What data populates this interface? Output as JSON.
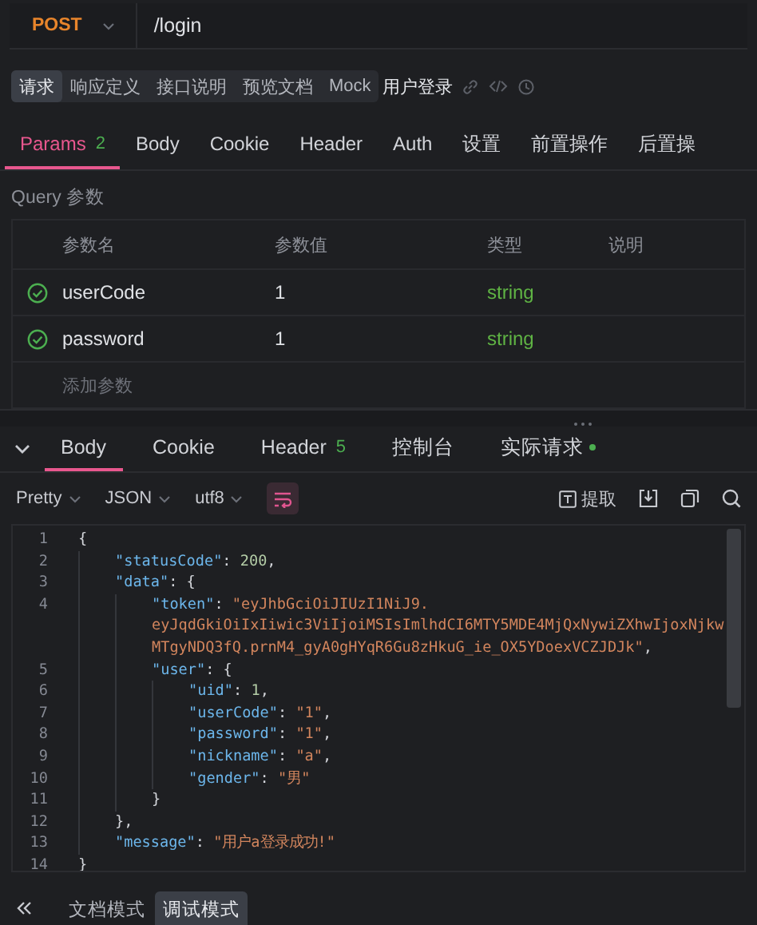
{
  "request": {
    "method": "POST",
    "url": "/login"
  },
  "doc_tabs": [
    {
      "label": "请求",
      "selected": true
    },
    {
      "label": "响应定义",
      "selected": false
    },
    {
      "label": "接口说明",
      "selected": false
    },
    {
      "label": "预览文档",
      "selected": false
    },
    {
      "label": "Mock",
      "selected": false
    }
  ],
  "api_name": "用户登录",
  "request_tabs": [
    {
      "label": "Params",
      "badge": "2",
      "selected": true
    },
    {
      "label": "Body",
      "selected": false
    },
    {
      "label": "Cookie",
      "selected": false
    },
    {
      "label": "Header",
      "selected": false
    },
    {
      "label": "Auth",
      "selected": false
    },
    {
      "label": "设置",
      "selected": false
    },
    {
      "label": "前置操作",
      "selected": false
    },
    {
      "label": "后置操",
      "selected": false
    }
  ],
  "query_label": "Query 参数",
  "params_table": {
    "columns": [
      "参数名",
      "参数值",
      "类型",
      "说明"
    ],
    "rows": [
      {
        "enabled": true,
        "name": "userCode",
        "value": "1",
        "type": "string"
      },
      {
        "enabled": true,
        "name": "password",
        "value": "1",
        "type": "string"
      }
    ],
    "add_row": "添加参数"
  },
  "response_tabs": [
    {
      "label": "Body",
      "selected": true
    },
    {
      "label": "Cookie",
      "selected": false
    },
    {
      "label": "Header",
      "badge": "5",
      "selected": false
    },
    {
      "label": "控制台",
      "selected": false
    },
    {
      "label": "实际请求",
      "dot": true,
      "selected": false
    }
  ],
  "response_toolbar": {
    "dropdowns": [
      "Pretty",
      "JSON",
      "utf8"
    ],
    "wrap_on": true,
    "extract_label": "提取"
  },
  "code_lines": [
    {
      "number": "1",
      "tokens": [
        {
          "kind": "punct",
          "text": "{"
        }
      ]
    },
    {
      "number": "2",
      "tokens": [
        {
          "kind": "key",
          "text": "\"statusCode\""
        },
        {
          "kind": "punct",
          "text": ": "
        },
        {
          "kind": "number",
          "text": "200"
        },
        {
          "kind": "punct",
          "text": ","
        }
      ]
    },
    {
      "number": "3",
      "tokens": [
        {
          "kind": "key",
          "text": "\"data\""
        },
        {
          "kind": "punct",
          "text": ": {"
        }
      ]
    },
    {
      "number": "4",
      "tokens": [
        {
          "kind": "key",
          "text": "\"token\""
        },
        {
          "kind": "punct",
          "text": ": "
        },
        {
          "kind": "string",
          "parts": [
            "\"eyJhbGciOiJIUzI1NiJ9.",
            "eyJqdGkiOiIxIiwic3ViIjoiMSIsImlhdCI6MTY5MDE4MjQxNywiZXhwIjoxNjkw",
            "MTgyNDQ3fQ.prnM4_gyA0gHYqR6Gu8zHkuG_ie_OX5YDoexVCZJDJk\""
          ]
        },
        {
          "kind": "punct",
          "text": ","
        }
      ]
    },
    {
      "number": "5",
      "tokens": [
        {
          "kind": "key",
          "text": "\"user\""
        },
        {
          "kind": "punct",
          "text": ": {"
        }
      ]
    },
    {
      "number": "6",
      "tokens": [
        {
          "kind": "key",
          "text": "\"uid\""
        },
        {
          "kind": "punct",
          "text": ": "
        },
        {
          "kind": "number",
          "text": "1"
        },
        {
          "kind": "punct",
          "text": ","
        }
      ]
    },
    {
      "number": "7",
      "tokens": [
        {
          "kind": "key",
          "text": "\"userCode\""
        },
        {
          "kind": "punct",
          "text": ": "
        },
        {
          "kind": "string",
          "text": "\"1\""
        },
        {
          "kind": "punct",
          "text": ","
        }
      ]
    },
    {
      "number": "8",
      "tokens": [
        {
          "kind": "key",
          "text": "\"password\""
        },
        {
          "kind": "punct",
          "text": ": "
        },
        {
          "kind": "string",
          "text": "\"1\""
        },
        {
          "kind": "punct",
          "text": ","
        }
      ]
    },
    {
      "number": "9",
      "tokens": [
        {
          "kind": "key",
          "text": "\"nickname\""
        },
        {
          "kind": "punct",
          "text": ": "
        },
        {
          "kind": "string",
          "text": "\"a\""
        },
        {
          "kind": "punct",
          "text": ","
        }
      ]
    },
    {
      "number": "10",
      "tokens": [
        {
          "kind": "key",
          "text": "\"gender\""
        },
        {
          "kind": "punct",
          "text": ": "
        },
        {
          "kind": "string",
          "text": "\"男\""
        }
      ]
    },
    {
      "number": "11",
      "tokens": [
        {
          "kind": "punct",
          "text": "}"
        }
      ]
    },
    {
      "number": "12",
      "tokens": [
        {
          "kind": "punct",
          "text": "},"
        }
      ]
    },
    {
      "number": "13",
      "tokens": [
        {
          "kind": "key",
          "text": "\"message\""
        },
        {
          "kind": "punct",
          "text": ": "
        },
        {
          "kind": "string",
          "text": "\"用户a登录成功!\""
        }
      ]
    },
    {
      "number": "14",
      "tokens": [
        {
          "kind": "punct",
          "text": "}"
        }
      ]
    }
  ],
  "mode_tabs": [
    {
      "label": "文档模式",
      "selected": false
    },
    {
      "label": "调试模式",
      "selected": true
    }
  ]
}
